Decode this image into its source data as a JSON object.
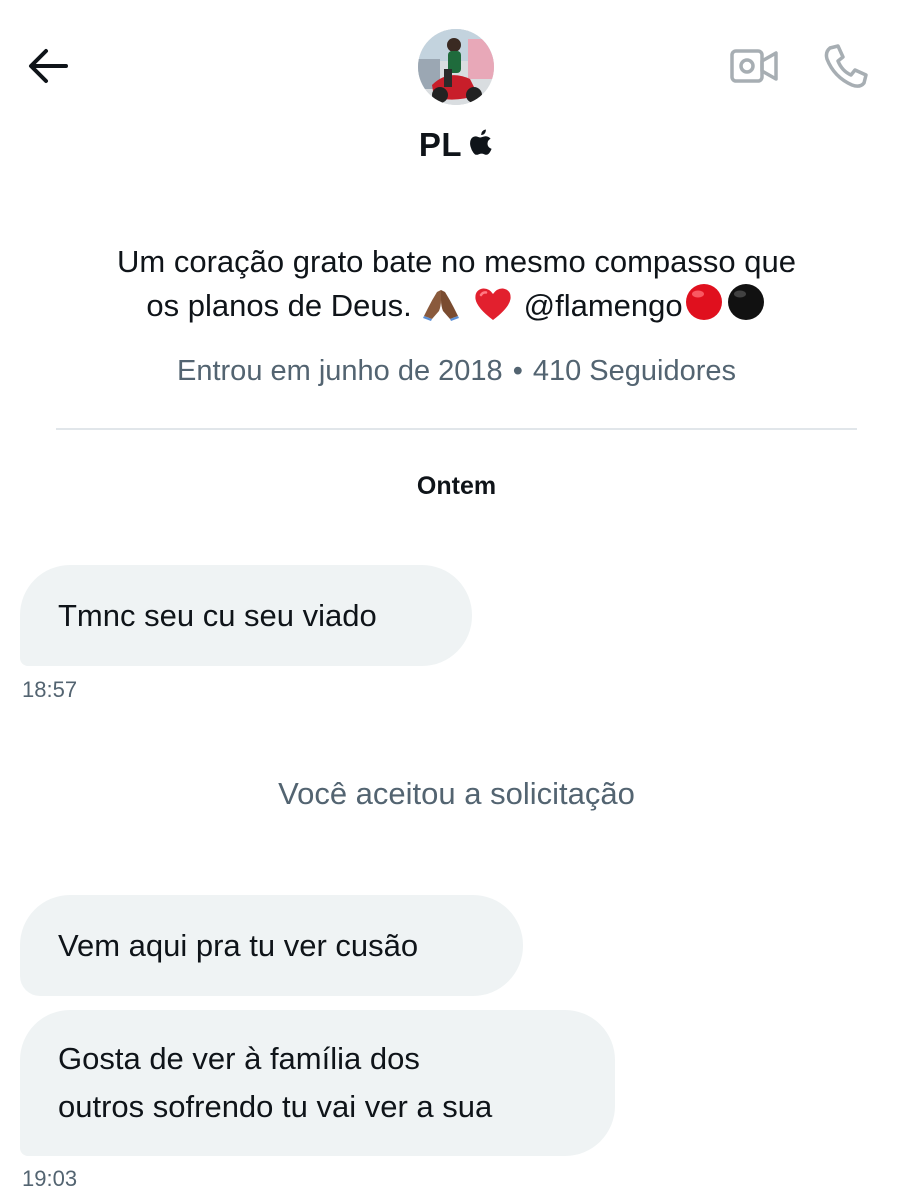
{
  "header": {
    "back_icon": "arrow-left-icon",
    "video_icon": "video-camera-icon",
    "call_icon": "phone-icon",
    "avatar_icon": "profile-photo"
  },
  "profile": {
    "display_name": "PL",
    "name_badge_icon": "apple-logo-icon",
    "bio_line_1": "Um coração grato bate no mesmo compasso que",
    "bio_line_2_text": "os planos de Deus.",
    "bio_emoji_1": "🙏🏾",
    "bio_emoji_2": "❤️",
    "bio_mention": "@flamengo",
    "bio_emoji_3": "🔴",
    "bio_emoji_4": "⚫",
    "joined": "Entrou em junho de 2018",
    "separator": "•",
    "followers": "410 Seguidores"
  },
  "conversation": {
    "day_label": "Ontem",
    "messages": [
      {
        "lines": [
          "Tmnc seu cu seu viado"
        ]
      },
      {
        "lines": [
          "Vem aqui pra tu ver cusão"
        ]
      },
      {
        "lines": [
          "Gosta de ver à família dos",
          "outros sofrendo tu vai ver a sua"
        ]
      }
    ],
    "timestamps": [
      "18:57",
      "19:03"
    ],
    "system_message": "Você aceitou a solicitação"
  },
  "colors": {
    "text_primary": "#0f1419",
    "text_secondary": "#536471",
    "bubble_background": "#eff3f4",
    "divider": "#e1e6ea",
    "icon_gray": "#a7aeb3",
    "red_circle": "#e0101e",
    "black_circle": "#111111"
  }
}
